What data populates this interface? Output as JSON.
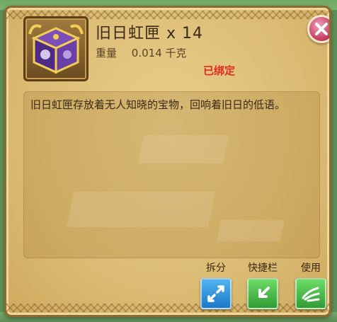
{
  "item": {
    "name": "旧日虹匣",
    "quantity": "x 14",
    "weight_label": "重量",
    "weight_value": "0.014 千克",
    "bound_status": "已绑定",
    "description": "旧日虹匣存放着无人知晓的宝物，回响着旧日的低语。",
    "icon": "purple-gold-chest-icon"
  },
  "actions": [
    {
      "label": "拆分",
      "icon": "split-arrows-icon",
      "color": "#2f8fdc"
    },
    {
      "label": "快捷栏",
      "icon": "arrow-left-icon",
      "color": "#3fb14a"
    },
    {
      "label": "使用",
      "icon": "use-hand-icon",
      "color": "#3fb14a"
    }
  ],
  "close": {
    "icon": "close-icon"
  },
  "colors": {
    "bound": "#e02c1f",
    "panel": "#dcbc74"
  }
}
